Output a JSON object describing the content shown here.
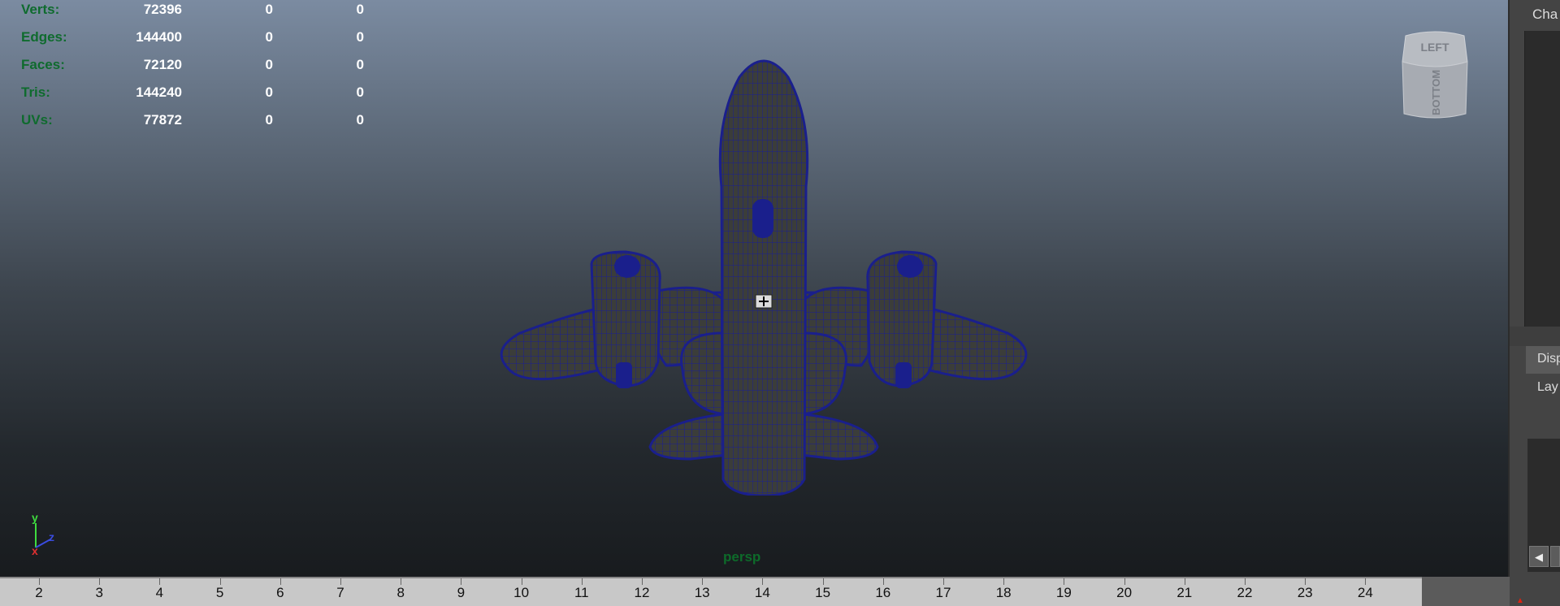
{
  "hud": {
    "rows": [
      {
        "label": "Verts:",
        "v1": "72396",
        "v2": "0",
        "v3": "0"
      },
      {
        "label": "Edges:",
        "v1": "144400",
        "v2": "0",
        "v3": "0"
      },
      {
        "label": "Faces:",
        "v1": "72120",
        "v2": "0",
        "v3": "0"
      },
      {
        "label": "Tris:",
        "v1": "144240",
        "v2": "0",
        "v3": "0"
      },
      {
        "label": "UVs:",
        "v1": "77872",
        "v2": "0",
        "v3": "0"
      }
    ]
  },
  "viewcube": {
    "face_top": "LEFT",
    "face_front": "BOTTOM"
  },
  "viewport": {
    "camera_label": "persp"
  },
  "axis": {
    "y": "y",
    "x": "x",
    "z": "z"
  },
  "side_panel": {
    "channel_box_tab": "Cha",
    "display_tab": "Disp",
    "layers_menu": "Lay",
    "scroll_left_glyph": "◀"
  },
  "timeline": {
    "ticks": [
      "2",
      "3",
      "4",
      "5",
      "6",
      "7",
      "8",
      "9",
      "10",
      "11",
      "12",
      "13",
      "14",
      "15",
      "16",
      "17",
      "18",
      "19",
      "20",
      "21",
      "22",
      "23",
      "24"
    ]
  },
  "colors": {
    "wire": "#1a1f8c",
    "mesh_fill": "#3a3c3a",
    "hud_label": "#0f6b2e",
    "hud_value": "#ffffff"
  }
}
